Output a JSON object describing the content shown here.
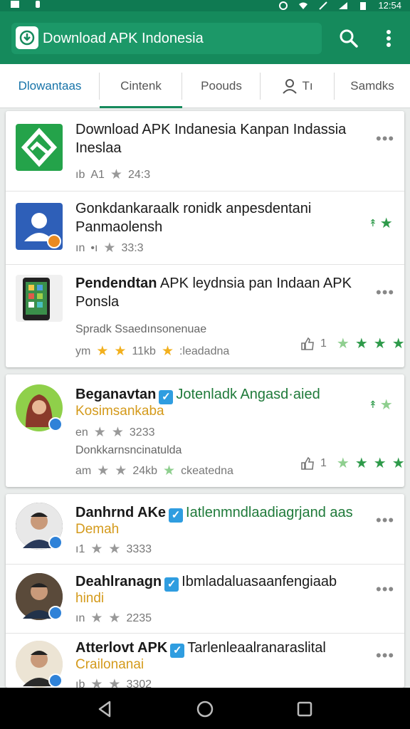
{
  "status_bar": {
    "time": "12:54"
  },
  "app_bar": {
    "title": "Download APK Indonesia",
    "search_icon": "search-icon",
    "more_icon": "more-vert-icon"
  },
  "tabs": [
    {
      "label": "Dlowantaas",
      "active_text": true
    },
    {
      "label": "Cintenk",
      "selected": true
    },
    {
      "label": "Poouds"
    },
    {
      "label": "Tı",
      "icon": "person-icon"
    },
    {
      "label": "Samdks"
    }
  ],
  "apps": [
    {
      "name": "Download APK Indanesia Kanpan Indassia",
      "name2": "Ineslaa",
      "meta_a": "ıb",
      "meta_b": "A1",
      "rating": "24:3"
    },
    {
      "name": "Gonkdankaraalk ronidk anpesdentani",
      "name2": "Panmaolensh",
      "meta_a": "ın",
      "meta_b": "•ı",
      "rating": "33:3"
    },
    {
      "name": "Pendendtan",
      "name_rest": "APK leydnsia pan Indaan APK",
      "name2": "Ponsla",
      "desc": "Spradk Ssaedınsonenuae",
      "meta_a": "ym",
      "meta_rating": "11kb",
      "meta_tail": ":leadadna",
      "count": "1"
    }
  ],
  "person": {
    "name": "Beganavtan",
    "tagline": "Jotenladk Angasd·aied",
    "sub": "Kosimsankaba",
    "meta_a": "en",
    "rating": "3233",
    "desc": "Donkkarnsncinatulda",
    "meta_b": "am",
    "meta_rating": "24kb",
    "meta_tail": "ckeatedna",
    "count": "1"
  },
  "people": [
    {
      "name": "Danhrnd AKe",
      "tagline": "Iatlenmndlaadiagrjand aas",
      "sub": "Demah",
      "meta": "ı1",
      "rating": "3333"
    },
    {
      "name": "Deahlranagn",
      "tagline": "Ibmladaluasaanfengiaab",
      "sub": "hindi",
      "meta": "ın",
      "rating": "2235"
    },
    {
      "name": "Atterlovt APK",
      "tagline": "Tarlenleaalranaraslital",
      "sub": "Crailonanai",
      "meta": "ıb",
      "rating": "3302"
    }
  ],
  "colors": {
    "green": "#158a5c",
    "tab_blue": "#1673a8",
    "orange": "#d49a1b",
    "star_green": "#2e9a4a",
    "star_gold": "#f2b01e"
  }
}
